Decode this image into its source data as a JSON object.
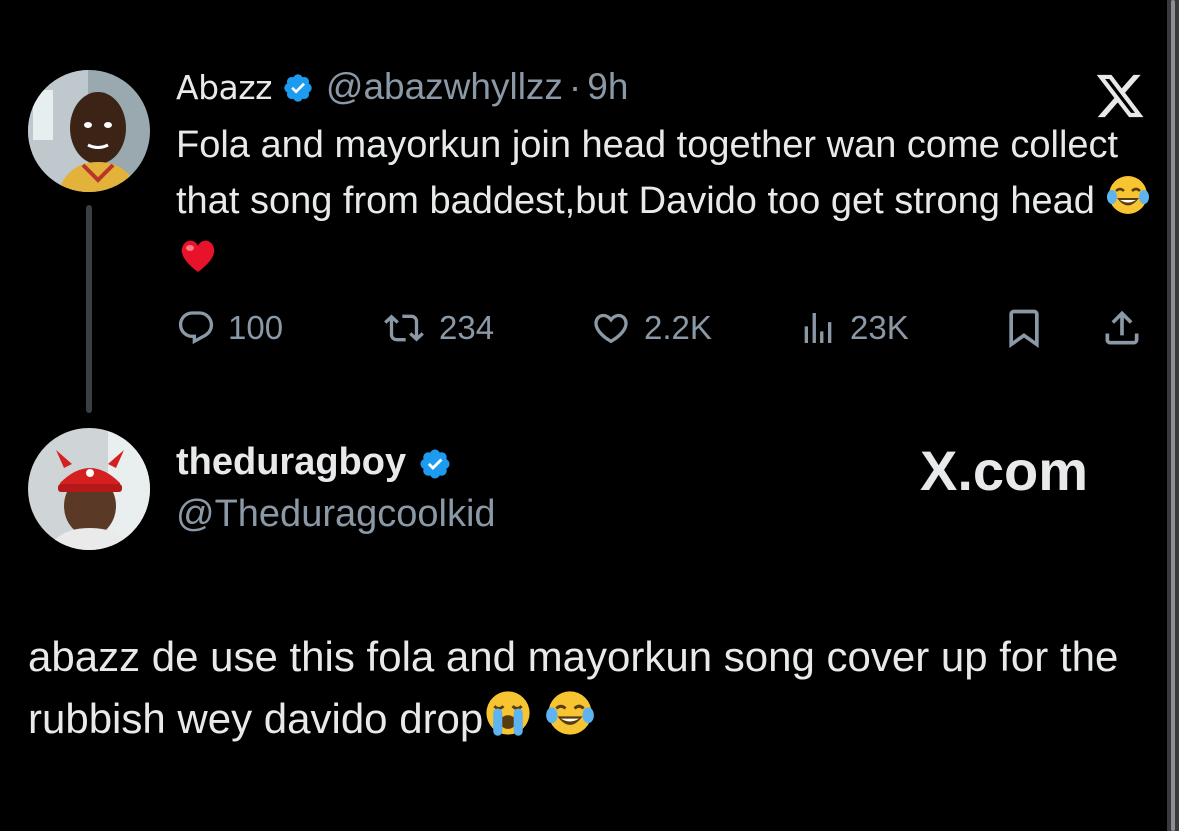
{
  "tweet": {
    "author_name": "Abazz",
    "handle": "@abazwhyllzz",
    "separator": "·",
    "time": "9h",
    "text": "Fola and mayorkun join head together wan come collect that song from baddest,but Davido too get strong head",
    "emojis": [
      "face-with-tears-of-joy",
      "red-heart"
    ],
    "stats": {
      "replies": "100",
      "reposts": "234",
      "likes": "2.2K",
      "views": "23K"
    },
    "icons": [
      "reply-icon",
      "repost-icon",
      "like-icon",
      "views-icon",
      "bookmark-icon",
      "share-icon"
    ]
  },
  "reply": {
    "author_name": "theduragboy",
    "handle": "@Theduragcoolkid",
    "text": "abazz de use this fola and mayorkun song cover up for the rubbish wey davido drop",
    "emojis": [
      "loudly-crying-face",
      "face-with-tears-of-joy"
    ]
  },
  "brand": {
    "logo": "x-logo",
    "watermark": "X.com"
  },
  "colors": {
    "background": "#000000",
    "text": "#e7e9ea",
    "muted": "#8b98a5",
    "verified": "#1d9bf0",
    "heart": "#f91880"
  }
}
